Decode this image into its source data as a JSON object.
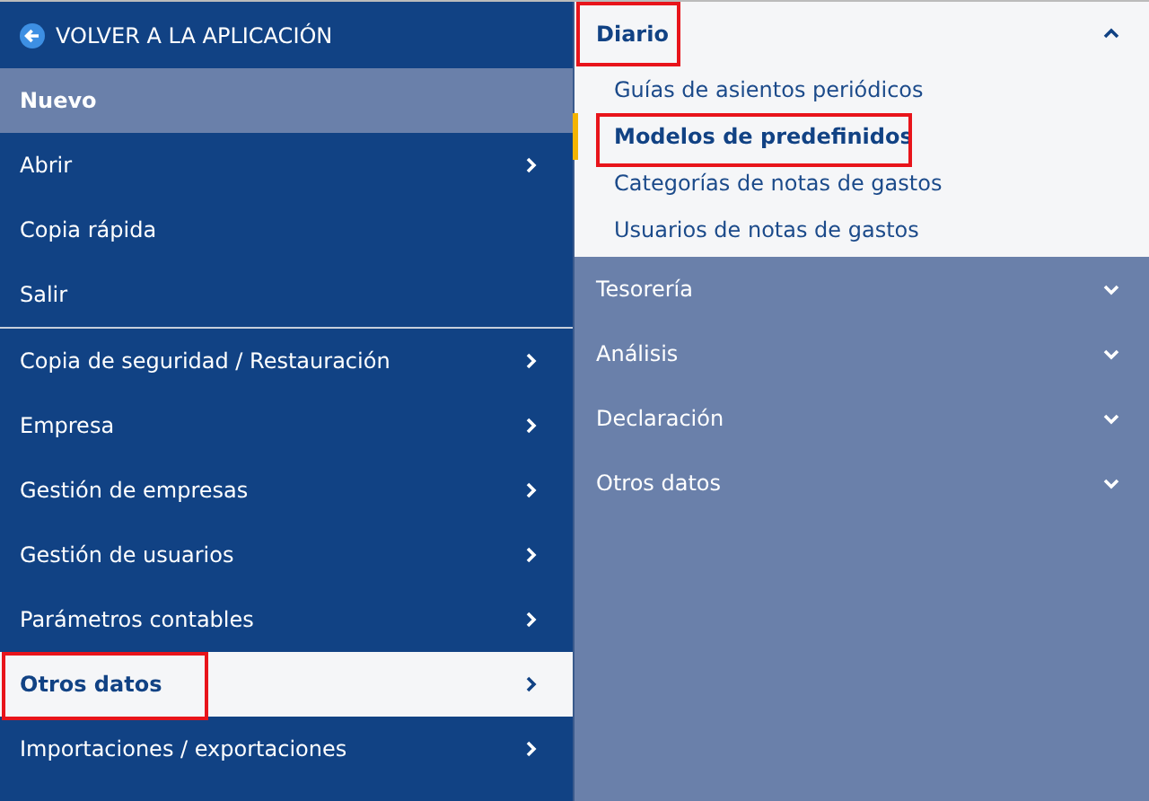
{
  "back_link": {
    "label": "VOLVER A LA APLICACIÓN"
  },
  "menu": [
    {
      "label": "Nuevo",
      "has_submenu": false,
      "hover": true,
      "selected": false,
      "outlined": false,
      "divider_after": false
    },
    {
      "label": "Abrir",
      "has_submenu": true,
      "hover": false,
      "selected": false,
      "outlined": false,
      "divider_after": false
    },
    {
      "label": "Copia rápida",
      "has_submenu": false,
      "hover": false,
      "selected": false,
      "outlined": false,
      "divider_after": false
    },
    {
      "label": "Salir",
      "has_submenu": false,
      "hover": false,
      "selected": false,
      "outlined": false,
      "divider_after": true
    },
    {
      "label": "Copia de seguridad / Restauración",
      "has_submenu": true,
      "hover": false,
      "selected": false,
      "outlined": false,
      "divider_after": false
    },
    {
      "label": "Empresa",
      "has_submenu": true,
      "hover": false,
      "selected": false,
      "outlined": false,
      "divider_after": false
    },
    {
      "label": "Gestión de empresas",
      "has_submenu": true,
      "hover": false,
      "selected": false,
      "outlined": false,
      "divider_after": false
    },
    {
      "label": "Gestión de usuarios",
      "has_submenu": true,
      "hover": false,
      "selected": false,
      "outlined": false,
      "divider_after": false
    },
    {
      "label": "Parámetros contables",
      "has_submenu": true,
      "hover": false,
      "selected": false,
      "outlined": false,
      "divider_after": false
    },
    {
      "label": "Otros datos",
      "has_submenu": true,
      "hover": false,
      "selected": true,
      "outlined": true,
      "divider_after": false
    },
    {
      "label": "Importaciones / exportaciones",
      "has_submenu": true,
      "hover": false,
      "selected": false,
      "outlined": false,
      "divider_after": false
    }
  ],
  "submenu": [
    {
      "label": "Diario",
      "expanded": true,
      "outlined": true,
      "items": [
        {
          "label": "Guías de asientos periódicos",
          "selected": false,
          "outlined": false
        },
        {
          "label": "Modelos de predefinidos",
          "selected": true,
          "outlined": true
        },
        {
          "label": "Categorías de notas de gastos",
          "selected": false,
          "outlined": false
        },
        {
          "label": "Usuarios de notas de gastos",
          "selected": false,
          "outlined": false
        }
      ]
    },
    {
      "label": "Tesorería",
      "expanded": false,
      "outlined": false
    },
    {
      "label": "Análisis",
      "expanded": false,
      "outlined": false
    },
    {
      "label": "Declaración",
      "expanded": false,
      "outlined": false
    },
    {
      "label": "Otros datos",
      "expanded": false,
      "outlined": false
    }
  ]
}
